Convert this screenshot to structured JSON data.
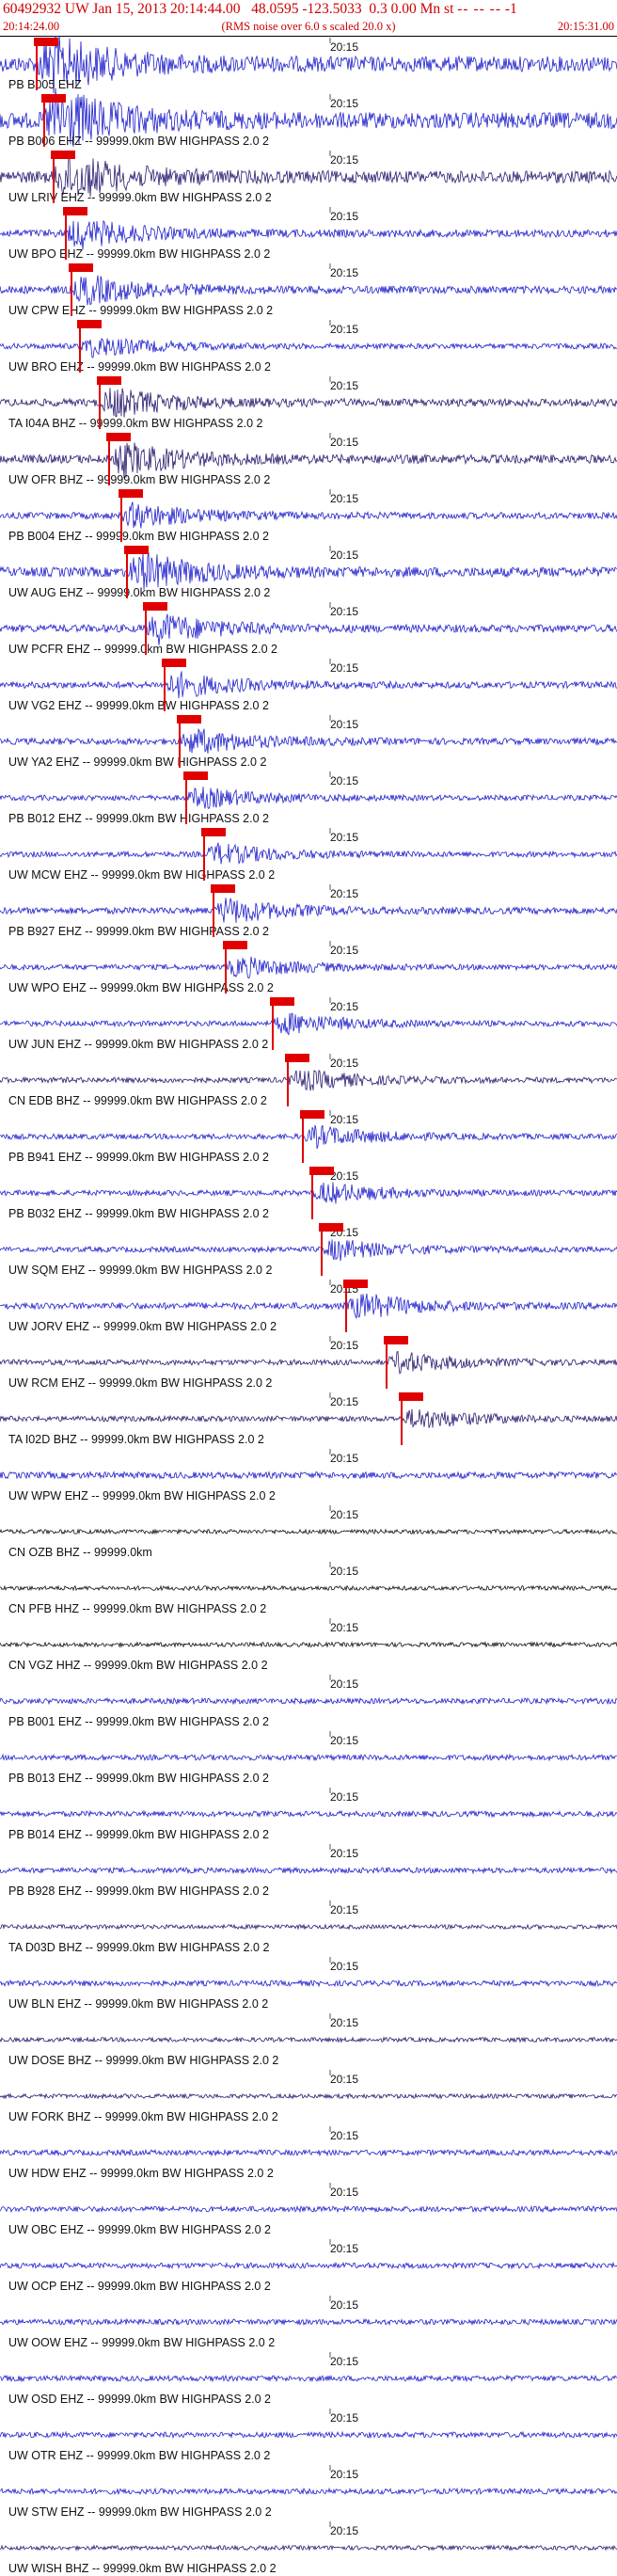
{
  "header": {
    "event_id": "60492932",
    "network": "UW",
    "date_time": "Jan 15, 2013 20:14:44.00",
    "lat": "48.0595",
    "lon": "-123.5033",
    "depth": "0.3",
    "magnitude": "0.00",
    "mag_type": "Mn",
    "status": "st",
    "dashes": "-- -- --",
    "trailing": "-1",
    "rms_note": "(RMS noise over 6.0 s scaled 20.0 x)",
    "start_time": "20:14:24.00",
    "end_time": "20:15:31.00"
  },
  "tick_label": "20:15",
  "colors": {
    "header": "#cc0000",
    "trace": "#1f1fcc",
    "trace_dark": "#2a1a6e",
    "pick": "#e00000",
    "grid": "#666666"
  },
  "traces": [
    {
      "label": "PB B005 EHZ",
      "pick": 0.058,
      "amp": 0.7,
      "color": "#1f1fcc"
    },
    {
      "label": "PB B006 EHZ -- 99999.0km BW  HIGHPASS  2.0  2",
      "pick": 0.07,
      "amp": 0.75,
      "color": "#1f1fcc"
    },
    {
      "label": "UW LRIV EHZ -- 99999.0km BW  HIGHPASS  2.0  2",
      "pick": 0.085,
      "amp": 0.55,
      "color": "#2a1a6e"
    },
    {
      "label": "UW BPO EHZ -- 99999.0km BW  HIGHPASS  2.0  2",
      "pick": 0.105,
      "amp": 0.35,
      "color": "#1f1fcc"
    },
    {
      "label": "UW CPW EHZ -- 99999.0km BW  HIGHPASS  2.0  2",
      "pick": 0.115,
      "amp": 0.35,
      "color": "#1f1fcc"
    },
    {
      "label": "UW BRO EHZ -- 99999.0km BW  HIGHPASS  2.0  2",
      "pick": 0.128,
      "amp": 0.25,
      "color": "#1f1fcc"
    },
    {
      "label": "TA I04A BHZ -- 99999.0km BW  HIGHPASS  2.0  2",
      "pick": 0.16,
      "amp": 0.35,
      "color": "#2a1a6e"
    },
    {
      "label": "UW OFR BHZ -- 99999.0km BW  HIGHPASS  2.0  2",
      "pick": 0.175,
      "amp": 0.4,
      "color": "#2a1a6e"
    },
    {
      "label": "PB B004 EHZ -- 99999.0km BW  HIGHPASS  2.0  2",
      "pick": 0.195,
      "amp": 0.3,
      "color": "#1f1fcc"
    },
    {
      "label": "UW AUG EHZ -- 99999.0km BW  HIGHPASS  2.0  2",
      "pick": 0.205,
      "amp": 0.45,
      "color": "#1f1fcc"
    },
    {
      "label": "UW PCFR EHZ -- 99999.0km BW  HIGHPASS  2.0  2",
      "pick": 0.235,
      "amp": 0.35,
      "color": "#1f1fcc"
    },
    {
      "label": "UW VG2 EHZ -- 99999.0km BW  HIGHPASS  2.0  2",
      "pick": 0.265,
      "amp": 0.3,
      "color": "#1f1fcc"
    },
    {
      "label": "UW YA2 EHZ -- 99999.0km BW  HIGHPASS  2.0  2",
      "pick": 0.29,
      "amp": 0.3,
      "color": "#1f1fcc"
    },
    {
      "label": "PB B012 EHZ -- 99999.0km BW  HIGHPASS  2.0  2",
      "pick": 0.3,
      "amp": 0.25,
      "color": "#1f1fcc"
    },
    {
      "label": "UW MCW EHZ -- 99999.0km BW  HIGHPASS  2.0  2",
      "pick": 0.33,
      "amp": 0.25,
      "color": "#1f1fcc"
    },
    {
      "label": "PB B927 EHZ -- 99999.0km BW  HIGHPASS  2.0  2",
      "pick": 0.345,
      "amp": 0.3,
      "color": "#1f1fcc"
    },
    {
      "label": "UW WPO EHZ -- 99999.0km BW  HIGHPASS  2.0  2",
      "pick": 0.365,
      "amp": 0.25,
      "color": "#1f1fcc"
    },
    {
      "label": "UW JUN EHZ -- 99999.0km BW  HIGHPASS  2.0  2",
      "pick": 0.44,
      "amp": 0.25,
      "color": "#1f1fcc"
    },
    {
      "label": "CN EDB BHZ -- 99999.0km BW  HIGHPASS  2.0  2",
      "pick": 0.465,
      "amp": 0.25,
      "color": "#2a1a6e"
    },
    {
      "label": "PB B941 EHZ -- 99999.0km BW  HIGHPASS  2.0  2",
      "pick": 0.49,
      "amp": 0.25,
      "color": "#1f1fcc"
    },
    {
      "label": "PB B032 EHZ -- 99999.0km BW  HIGHPASS  2.0  2",
      "pick": 0.505,
      "amp": 0.25,
      "color": "#1f1fcc"
    },
    {
      "label": "UW SQM EHZ -- 99999.0km BW  HIGHPASS  2.0  2",
      "pick": 0.52,
      "amp": 0.25,
      "color": "#1f1fcc"
    },
    {
      "label": "UW JORV EHZ -- 99999.0km BW  HIGHPASS  2.0  2",
      "pick": 0.56,
      "amp": 0.3,
      "color": "#1f1fcc"
    },
    {
      "label": "UW RCM EHZ -- 99999.0km BW  HIGHPASS  2.0  2",
      "pick": 0.625,
      "amp": 0.25,
      "color": "#2a1a6e"
    },
    {
      "label": "TA I02D BHZ -- 99999.0km BW  HIGHPASS  2.0  2",
      "pick": 0.65,
      "amp": 0.25,
      "color": "#2a1a6e"
    },
    {
      "label": "UW WPW EHZ -- 99999.0km BW  HIGHPASS  2.0  2",
      "pick": null,
      "amp": 0.3,
      "color": "#1f1fcc"
    },
    {
      "label": "CN OZB BHZ -- 99999.0km",
      "pick": null,
      "amp": 0.2,
      "color": "#111111"
    },
    {
      "label": "CN PFB HHZ -- 99999.0km BW  HIGHPASS  2.0  2",
      "pick": null,
      "amp": 0.2,
      "color": "#111111"
    },
    {
      "label": "CN VGZ HHZ -- 99999.0km BW  HIGHPASS  2.0  2",
      "pick": null,
      "amp": 0.2,
      "color": "#111111"
    },
    {
      "label": "PB B001 EHZ -- 99999.0km BW  HIGHPASS  2.0  2",
      "pick": null,
      "amp": 0.25,
      "color": "#1f1fcc"
    },
    {
      "label": "PB B013 EHZ -- 99999.0km BW  HIGHPASS  2.0  2",
      "pick": null,
      "amp": 0.25,
      "color": "#1f1fcc"
    },
    {
      "label": "PB B014 EHZ -- 99999.0km BW  HIGHPASS  2.0  2",
      "pick": null,
      "amp": 0.25,
      "color": "#1f1fcc"
    },
    {
      "label": "PB B928 EHZ -- 99999.0km BW  HIGHPASS  2.0  2",
      "pick": null,
      "amp": 0.25,
      "color": "#1f1fcc"
    },
    {
      "label": "TA D03D BHZ -- 99999.0km BW  HIGHPASS  2.0  2",
      "pick": null,
      "amp": 0.2,
      "color": "#2a1a6e"
    },
    {
      "label": "UW BLN EHZ -- 99999.0km BW  HIGHPASS  2.0  2",
      "pick": null,
      "amp": 0.25,
      "color": "#1f1fcc"
    },
    {
      "label": "UW DOSE BHZ -- 99999.0km BW  HIGHPASS  2.0  2",
      "pick": null,
      "amp": 0.2,
      "color": "#2a1a6e"
    },
    {
      "label": "UW FORK BHZ -- 99999.0km BW  HIGHPASS  2.0  2",
      "pick": null,
      "amp": 0.2,
      "color": "#2a1a6e"
    },
    {
      "label": "UW HDW EHZ -- 99999.0km BW  HIGHPASS  2.0  2",
      "pick": null,
      "amp": 0.25,
      "color": "#1f1fcc"
    },
    {
      "label": "UW OBC EHZ -- 99999.0km BW  HIGHPASS  2.0  2",
      "pick": null,
      "amp": 0.25,
      "color": "#1f1fcc"
    },
    {
      "label": "UW OCP EHZ -- 99999.0km BW  HIGHPASS  2.0  2",
      "pick": null,
      "amp": 0.25,
      "color": "#1f1fcc"
    },
    {
      "label": "UW OOW EHZ -- 99999.0km BW  HIGHPASS  2.0  2",
      "pick": null,
      "amp": 0.25,
      "color": "#1f1fcc"
    },
    {
      "label": "UW OSD EHZ -- 99999.0km BW  HIGHPASS  2.0  2",
      "pick": null,
      "amp": 0.25,
      "color": "#1f1fcc"
    },
    {
      "label": "UW OTR EHZ -- 99999.0km BW  HIGHPASS  2.0  2",
      "pick": null,
      "amp": 0.25,
      "color": "#1f1fcc"
    },
    {
      "label": "UW STW EHZ -- 99999.0km BW  HIGHPASS  2.0  2",
      "pick": null,
      "amp": 0.25,
      "color": "#1f1fcc"
    },
    {
      "label": "UW WISH BHZ -- 99999.0km BW  HIGHPASS  2.0  2",
      "pick": null,
      "amp": 0.2,
      "color": "#2a1a6e"
    }
  ]
}
